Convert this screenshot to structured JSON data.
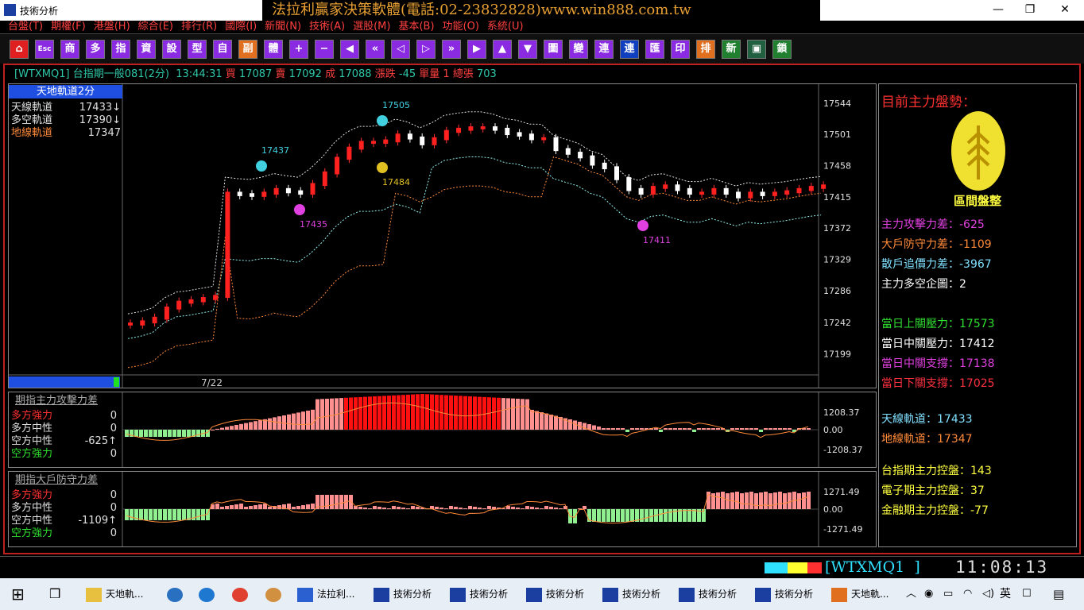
{
  "window": {
    "title": "技術分析",
    "banner": "法拉利贏家決策軟體(電話:02-23832828)www.win888.com.tw"
  },
  "menu": [
    "台盤(T)",
    "期權(F)",
    "港盤(H)",
    "綜合(E)",
    "排行(R)",
    "國際(I)",
    "新聞(N)",
    "技術(A)",
    "選股(M)",
    "基本(B)",
    "功能(O)",
    "系統(U)"
  ],
  "toolbar": [
    "⌂",
    "Esc",
    "商",
    "多",
    "指",
    "資",
    "設",
    "型",
    "自",
    "副",
    "體",
    "+",
    "−",
    "◀",
    "«",
    "◁",
    "▷",
    "»",
    "▶",
    "▲",
    "▼",
    "圖",
    "變",
    "連",
    "連",
    "匯",
    "印",
    "排",
    "新",
    "▣",
    "鎖"
  ],
  "quote": {
    "symbol": "[WTXMQ1]",
    "name": "台指期一般081(2分)",
    "time": "13:44:31",
    "buy_label": "買",
    "buy": "17087",
    "sell_label": "賣",
    "sell": "17092",
    "deal_label": "成",
    "deal": "17088",
    "chg_label": "漲跌",
    "chg": "-45",
    "vol_label": "單量",
    "vol": "1",
    "total_label": "總張",
    "total": "703"
  },
  "main_chart": {
    "title": "天地軌道2分",
    "legend": [
      {
        "label": "天線軌道",
        "value": "17433↓",
        "color": "#e0e0e0"
      },
      {
        "label": "多空軌道",
        "value": "17390↓",
        "color": "#e0e0e0"
      },
      {
        "label": "地線軌道",
        "value": "17347",
        "color": "#ff8a3a"
      }
    ],
    "y_ticks": [
      "17544",
      "17501",
      "17458",
      "17415",
      "17372",
      "17329",
      "17286",
      "17242",
      "17199"
    ],
    "date_label": "7/22",
    "markers": [
      {
        "label": "17505",
        "color": "#40d0e0"
      },
      {
        "label": "17437",
        "color": "#40d0e0"
      },
      {
        "label": "17484",
        "color": "#e0c020"
      },
      {
        "label": "17435",
        "color": "#e040e0"
      },
      {
        "label": "17411",
        "color": "#e040e0"
      }
    ]
  },
  "indicator1": {
    "title": "期指主力攻擊力差",
    "legend": [
      {
        "label": "多方強力",
        "value": "0",
        "color": "#ff3030"
      },
      {
        "label": "多方中性",
        "value": "0",
        "color": "#e0e0e0"
      },
      {
        "label": "空方中性",
        "value": "-625↑",
        "color": "#e0e0e0"
      },
      {
        "label": "空方強力",
        "value": "0",
        "color": "#30e030"
      }
    ],
    "y_ticks": [
      "1208.37",
      "0.00",
      "-1208.37"
    ]
  },
  "indicator2": {
    "title": "期指大戶防守力差",
    "legend": [
      {
        "label": "多方強力",
        "value": "0",
        "color": "#ff3030"
      },
      {
        "label": "多方中性",
        "value": "0",
        "color": "#e0e0e0"
      },
      {
        "label": "空方中性",
        "value": "-1109↑",
        "color": "#e0e0e0"
      },
      {
        "label": "空方強力",
        "value": "0",
        "color": "#30e030"
      }
    ],
    "y_ticks": [
      "1271.49",
      "0.00",
      "-1271.49"
    ]
  },
  "right_panel": {
    "heading": "目前主力盤勢：",
    "state": "區間盤整",
    "items": [
      {
        "label": "主力攻擊力差：",
        "value": "-625",
        "color": "#e040e0"
      },
      {
        "label": "大戶防守力差：",
        "value": "-1109",
        "color": "#ff8a3a"
      },
      {
        "label": "散戶追價力差：",
        "value": "-3967",
        "color": "#80e0ff"
      },
      {
        "label": "主力多空企圖：",
        "value": "2",
        "color": "#ffffff"
      },
      {
        "label": "當日上關壓力：",
        "value": "17573",
        "color": "#30e030"
      },
      {
        "label": "當日中關壓力：",
        "value": "17412",
        "color": "#ffffff"
      },
      {
        "label": "當日中關支撐：",
        "value": "17138",
        "color": "#e040e0"
      },
      {
        "label": "當日下關支撐：",
        "value": "17025",
        "color": "#ff3040"
      },
      {
        "label": "天線軌道：",
        "value": "17433",
        "color": "#80e0ff"
      },
      {
        "label": "地線軌道：",
        "value": "17347",
        "color": "#ff8a3a"
      },
      {
        "label": "台指期主力控盤：",
        "value": "143",
        "color": "#ffff40"
      },
      {
        "label": "電子期主力控盤：",
        "value": "37",
        "color": "#ffff40"
      },
      {
        "label": "金融期主力控盤：",
        "value": "-77",
        "color": "#ffff40"
      }
    ]
  },
  "status": {
    "symbol": "[WTXMQ1  ]",
    "clock": "11:08:13"
  },
  "taskbar": [
    {
      "label": "天地軌..."
    },
    {
      "label": "法拉利..."
    },
    {
      "label": "技術分析"
    },
    {
      "label": "技術分析"
    },
    {
      "label": "技術分析"
    },
    {
      "label": "技術分析"
    },
    {
      "label": "技術分析"
    },
    {
      "label": "技術分析"
    },
    {
      "label": "天地軌..."
    }
  ],
  "tray": {
    "ime": "英"
  },
  "chart_data": [
    {
      "type": "candlestick",
      "title": "天地軌道2分",
      "y_ticks": [
        17544,
        17501,
        17458,
        17415,
        17372,
        17329,
        17286,
        17242,
        17199
      ],
      "ylim": [
        17170,
        17570
      ],
      "markers": [
        17505,
        17437,
        17484,
        17435,
        17411
      ],
      "close_path": [
        17240,
        17243,
        17248,
        17262,
        17270,
        17272,
        17275,
        17278,
        17420,
        17418,
        17417,
        17420,
        17425,
        17422,
        17420,
        17432,
        17448,
        17468,
        17482,
        17490,
        17490,
        17492,
        17500,
        17496,
        17488,
        17495,
        17505,
        17508,
        17510,
        17510,
        17508,
        17502,
        17500,
        17495,
        17495,
        17480,
        17475,
        17470,
        17460,
        17455,
        17440,
        17425,
        17420,
        17428,
        17430,
        17425,
        17420,
        17420,
        17425,
        17420,
        17415,
        17420,
        17418,
        17420,
        17422,
        17425,
        17428,
        17430
      ]
    },
    {
      "type": "bar",
      "title": "期指主力攻擊力差",
      "ylim": [
        -1208.37,
        1208.37
      ]
    },
    {
      "type": "bar",
      "title": "期指大戶防守力差",
      "ylim": [
        -1271.49,
        1271.49
      ]
    }
  ]
}
